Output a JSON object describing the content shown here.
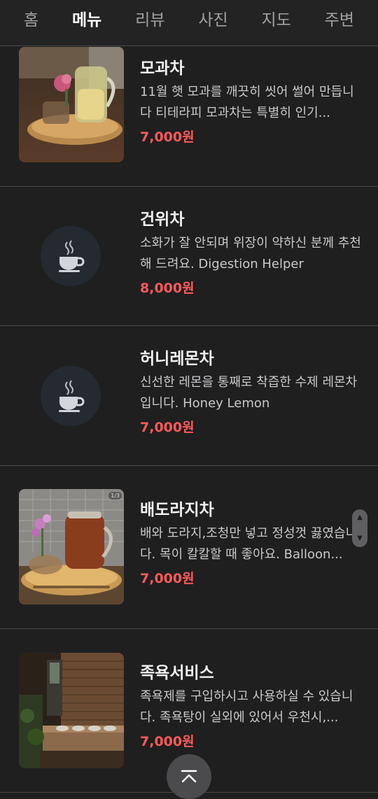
{
  "tabs": [
    {
      "label": "홈",
      "active": false
    },
    {
      "label": "메뉴",
      "active": true
    },
    {
      "label": "리뷰",
      "active": false
    },
    {
      "label": "사진",
      "active": false
    },
    {
      "label": "지도",
      "active": false
    },
    {
      "label": "주변",
      "active": false
    }
  ],
  "menu": {
    "items": [
      {
        "name": "모과차",
        "description": "11월 햇 모과를 깨끗히 씻어 썰어 만듭니다 티테라피 모과차는 특별히 인기...",
        "price": "7,000원",
        "image": "photo"
      },
      {
        "name": "건위차",
        "description": "소화가 잘 안되며 위장이 약하신 분께 추천해 드려요. Digestion Helper",
        "price": "8,000원",
        "image": "cup-placeholder-icon"
      },
      {
        "name": "허니레몬차",
        "description": "신선한 레몬을 통째로 착즙한 수제 레몬차입니다. Honey Lemon",
        "price": "7,000원",
        "image": "cup-placeholder-icon"
      },
      {
        "name": "배도라지차",
        "description": "배와 도라지,조청만 넣고 정성껏 끓였습니다. 목이 칼칼할 때 좋아요. Balloon...",
        "price": "7,000원",
        "image": "photo",
        "photo_counter": "1/3"
      },
      {
        "name": "족욕서비스",
        "description": "족욕제를 구입하시고 사용하실 수 있습니다. 족욕탕이 실외에 있어서 우천시,...",
        "price": "7,000원",
        "image": "photo"
      }
    ]
  },
  "colors": {
    "background": "#1f1f20",
    "divider": "#4a4a4c",
    "price": "#ff5a5a",
    "active_tab": "#ffffff",
    "inactive_tab": "#a0a0a2"
  },
  "icons": {
    "scroll_up": "chevron-up-icon",
    "scroll_down": "chevron-down-icon",
    "back_to_top": "arrow-up-to-top-icon"
  }
}
